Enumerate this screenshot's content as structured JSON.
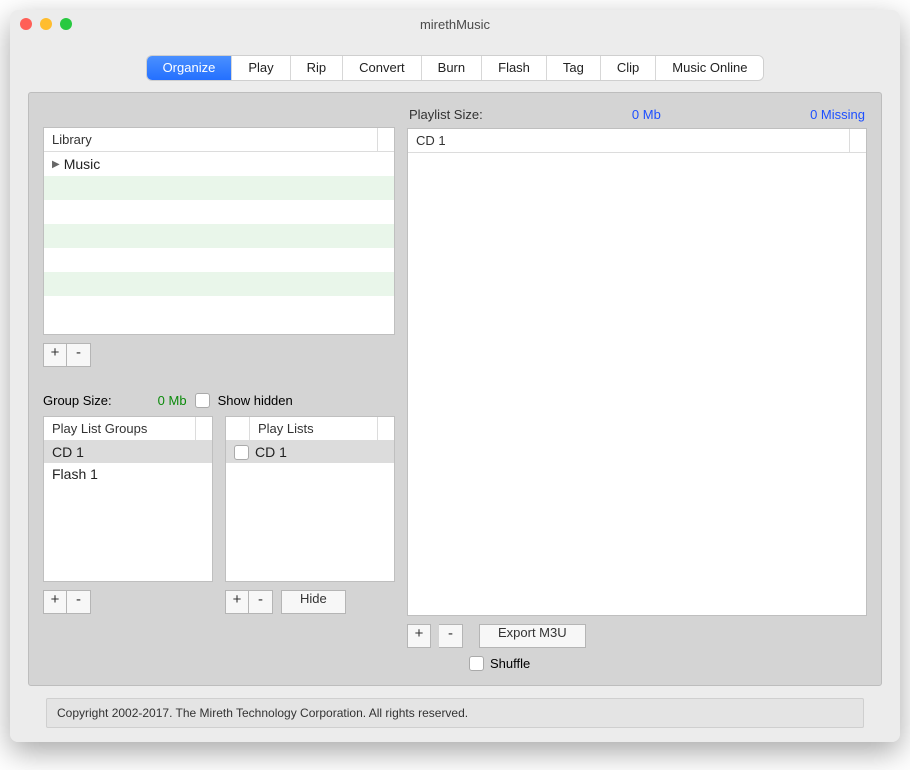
{
  "window": {
    "title": "mirethMusic"
  },
  "tabs": [
    "Organize",
    "Play",
    "Rip",
    "Convert",
    "Burn",
    "Flash",
    "Tag",
    "Clip",
    "Music Online"
  ],
  "activeTab": "Organize",
  "library": {
    "header": "Library",
    "items": [
      "Music"
    ]
  },
  "buttons": {
    "plus": "+",
    "minus": "-",
    "hide": "Hide",
    "exportM3U": "Export M3U"
  },
  "groupSize": {
    "label": "Group Size:",
    "value": "0",
    "unit": "Mb",
    "showHiddenLabel": "Show hidden"
  },
  "playlistGroups": {
    "header": "Play List Groups",
    "items": [
      "CD 1",
      "Flash 1"
    ],
    "selected": "CD 1"
  },
  "playlists": {
    "header": "Play Lists",
    "items": [
      "CD 1"
    ],
    "selected": "CD 1"
  },
  "playlistSize": {
    "label": "Playlist Size:",
    "value": "0",
    "unit": "Mb",
    "missing": "0",
    "missingLabel": "Missing"
  },
  "rightList": {
    "header": "CD 1",
    "items": []
  },
  "shuffleLabel": "Shuffle",
  "footer": "Copyright 2002-2017.  The Mireth Technology Corporation. All rights reserved."
}
